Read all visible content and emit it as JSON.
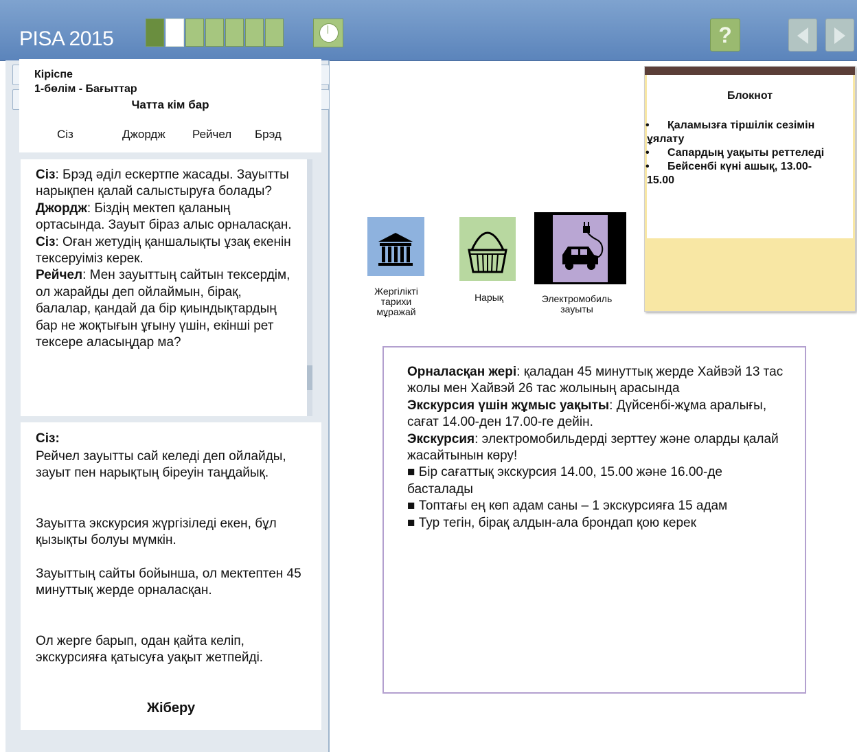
{
  "header": {
    "app_title": "PISA 2015",
    "progress": {
      "total_segments": 7,
      "completed": 1,
      "current_index": 1
    },
    "help_label": "?"
  },
  "chat": {
    "breadcrumb": {
      "intro": "Кіріспе",
      "section": "1-бөлім - Бағыттар"
    },
    "participants_title": "Чатта кім бар",
    "participants": [
      "Сіз",
      "Джордж",
      "Рейчел",
      "Брэд"
    ],
    "messages": [
      {
        "speaker": "Сіз",
        "text": ": Брэд әділ ескертпе жасады. Зауытты нарықпен қалай салыстыруға болады?"
      },
      {
        "speaker": "Джордж",
        "text": ": Біздің мектеп қаланың ортасында. Зауыт біраз алыс орналасқан."
      },
      {
        "speaker": "Сіз",
        "text": ": Оған жетудің қаншалықты ұзақ екенін тексеруіміз керек."
      },
      {
        "speaker": "Рейчел",
        "text": ": Мен зауыттың сайтын тексердім, ол жарайды деп ойлаймын, бірақ, балалар, қандай да бір қиындықтардың бар не жоқтығын ұғыну үшін, екінші рет тексере аласыңдар ма?"
      }
    ]
  },
  "response": {
    "speaker": "Сіз:",
    "paragraphs": [
      "Рейчел зауытты сай келеді деп ойлайды, зауыт пен нарықтың біреуін таңдайық.",
      "Зауытта экскурсия жүргізіледі екен, бұл қызықты болуы мүмкін.",
      "Зауыттың сайты бойынша, ол мектептен 45 минуттық жерде орналасқан.",
      "Ол жерге барып, одан қайта келіп, экскурсияға қатысуға уақыт жетпейді."
    ],
    "send_label": "Жіберу"
  },
  "locations": {
    "museum": "Жергілікті тарихи мұражай",
    "market": "Нарық",
    "factory": "Электромобиль зауыты"
  },
  "notepad": {
    "title": "Блокнот",
    "items": [
      "Қаламызға тіршілік сезімін ұялату",
      "Сапардың уақыты реттеледі",
      "Бейсенбі күні ашық, 13.00-15.00"
    ]
  },
  "info": {
    "location_label": "Орналасқан жері",
    "location_text": ": қаладан 45 минуттық жерде Хайвэй 13 тас жолы мен Хайвэй 26 тас жолының арасында",
    "hours_label": "Экскурсия үшін жұмыс уақыты",
    "hours_text": ": Дүйсенбі-жұма аралығы, сағат 14.00-ден 17.00-ге дейін.",
    "tour_label": "Экскурсия",
    "tour_text": ": электромобильдерді зерттеу және оларды қалай жасайтынын көру!",
    "bullets": [
      "■ Бір сағаттық экскурсия 14.00, 15.00 және 16.00-де басталады",
      "■ Топтағы ең көп адам саны – 1 экскурсияға 15 адам",
      "■ Тур тегін, бірақ алдын-ала брондап қою керек"
    ]
  }
}
